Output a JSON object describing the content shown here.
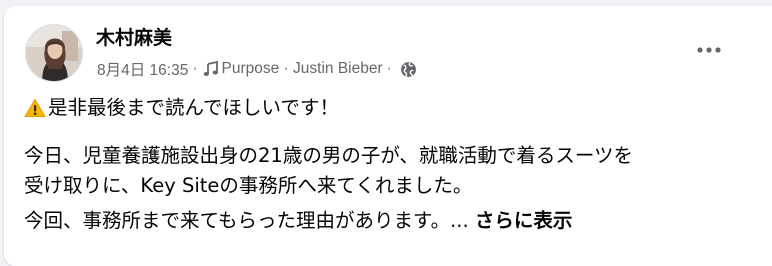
{
  "post": {
    "author_name": "木村麻美",
    "date": "8月4日 16:35",
    "separator": "·",
    "music": "Purpose · Justin Bieber",
    "audience_icon": "globe-icon",
    "music_icon": "music-note-icon",
    "line1": "是非最後まで読んでほしいです！",
    "line2": "今日、児童養護施設出身の21歳の男の子が、就職活動で着るスーツを",
    "line3": "受け取りに、Key Siteの事務所へ来てくれました。",
    "line4": "今回、事務所まで来てもらった理由があります。...",
    "see_more": "さらに表示"
  },
  "colors": {
    "text_primary": "#050505",
    "text_secondary": "#65676b",
    "card_bg": "#ffffff",
    "page_bg": "#f0f2f5",
    "warning": "#f7b500"
  }
}
